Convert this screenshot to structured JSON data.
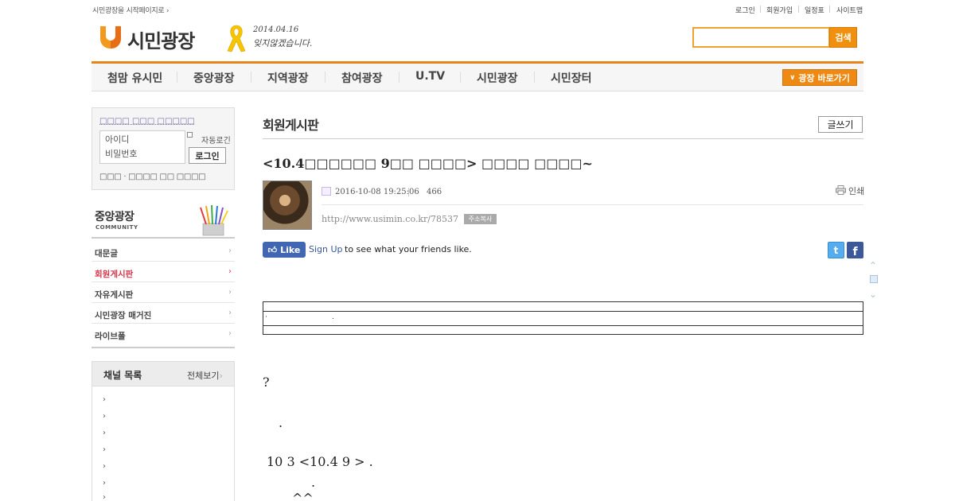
{
  "top_bar": {
    "start_page": "시민광장을 시작페이지로 ›",
    "links": [
      "로그인",
      "회원가입",
      "일정표",
      "사이트맵"
    ]
  },
  "logo": {
    "text": "시민광장",
    "memorial_date": "2014.04.16",
    "memorial_text": "잊지않겠습니다."
  },
  "search": {
    "value": "",
    "button": "검색"
  },
  "nav": {
    "items": [
      "첨맘 유시민",
      "중앙광장",
      "지역광장",
      "참여광장",
      "U.TV",
      "시민광장",
      "시민장터"
    ],
    "plaza_button": "광장 바로가기"
  },
  "login": {
    "caption": "□□□□ □□□ □□□□□",
    "id_placeholder": "아이디",
    "pw_placeholder": "비밀번호",
    "auto_label": "자동로긴",
    "button": "로그인",
    "find_links": "□□□ · □□□□ □□  □□□□"
  },
  "category": {
    "title": "중앙광장",
    "subtitle": "COMMUNITY",
    "items": [
      {
        "label": "대문글",
        "active": false
      },
      {
        "label": "회원게시판",
        "active": true
      },
      {
        "label": "자유게시판",
        "active": false
      },
      {
        "label": "시민광장 매거진",
        "active": false
      },
      {
        "label": "라이브폴",
        "active": false
      }
    ],
    "active_color": "#d8344a"
  },
  "channels": {
    "title": "채널 목록",
    "view_all": "전체보기",
    "bullets": [
      "›",
      "›",
      "›",
      "›",
      "›",
      "›",
      "›"
    ]
  },
  "board": {
    "title": "회원게시판",
    "write_button": "글쓰기"
  },
  "post": {
    "title": "<10.4□□□□□□ 9□□ □□□□> □□□□ □□□□~",
    "date": "2016-10-08 19:25:06",
    "views": "466",
    "print_label": "인쇄",
    "url": "http://www.usimin.co.kr/78537",
    "copy_button": "주소복사"
  },
  "social": {
    "like_label": "Like",
    "signup_link": "Sign Up",
    "signup_rest": "to see what your friends like.",
    "twitter_glyph": "t",
    "facebook_glyph": "f"
  },
  "content": {
    "table_dot1": "·",
    "table_dot2": ".",
    "lines": [
      "?",
      ".",
      "10 3   <10.4 9 >  .",
      ".",
      "^^"
    ]
  },
  "colors": {
    "accent": "#e8851a",
    "facebook": "#4267b2"
  }
}
